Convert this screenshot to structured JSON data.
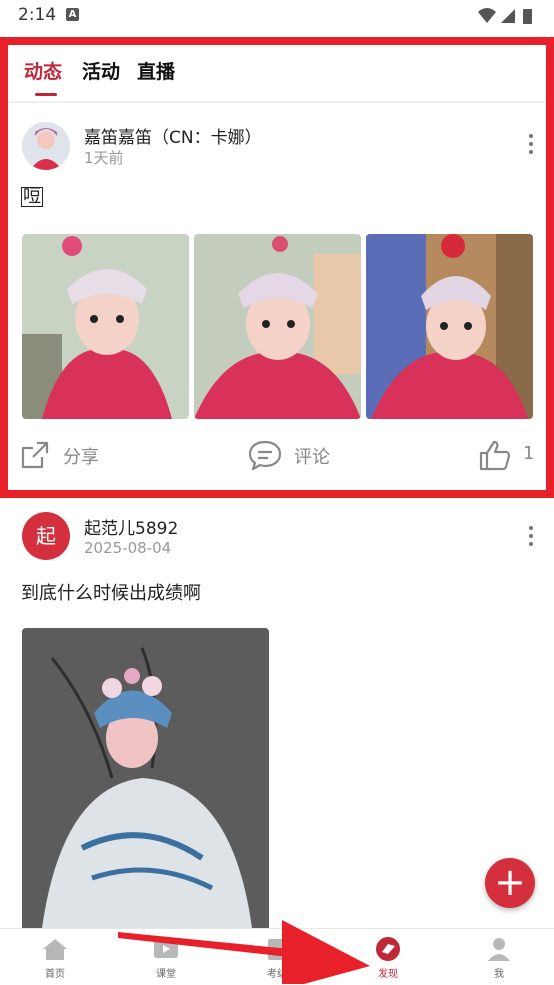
{
  "status_bar": {
    "time": "2:14",
    "notification": "A"
  },
  "tabs": [
    {
      "label": "动态",
      "active": true
    },
    {
      "label": "活动",
      "active": false
    },
    {
      "label": "直播",
      "active": false
    }
  ],
  "posts": [
    {
      "author": "嘉笛嘉笛（CN：卡娜）",
      "time": "1天前",
      "text": "哣",
      "photo_count": 3,
      "actions": {
        "share": "分享",
        "comment": "评论",
        "like_count": "1"
      }
    },
    {
      "author": "起范儿5892",
      "avatar_text": "起",
      "time": "2025-08-04",
      "text": "到底什么时候出成绩啊",
      "photo_count": 1
    }
  ],
  "fab": {
    "label": "+"
  },
  "bottom_nav": [
    {
      "label": "首页",
      "icon": "home-icon"
    },
    {
      "label": "课堂",
      "icon": "video-icon"
    },
    {
      "label": "考级",
      "icon": "exam-icon"
    },
    {
      "label": "发现",
      "icon": "discover-icon",
      "active": true
    },
    {
      "label": "我",
      "icon": "person-icon"
    }
  ],
  "colors": {
    "accent": "#c0283a",
    "highlight": "#e8202a"
  }
}
